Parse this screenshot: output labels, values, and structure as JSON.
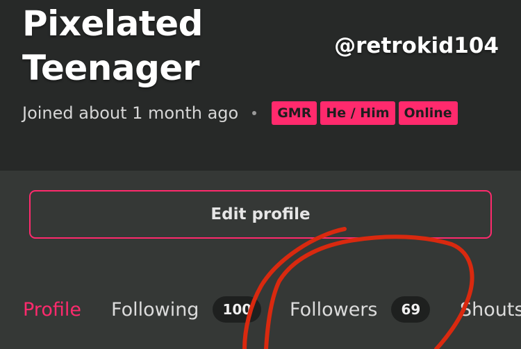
{
  "profile": {
    "display_name": "Pixelated Teenager",
    "handle": "@retrokid104",
    "joined": "Joined about 1 month ago",
    "badges": [
      "GMR",
      "He / Him",
      "Online"
    ]
  },
  "actions": {
    "edit_profile_label": "Edit profile"
  },
  "tabs": [
    {
      "label": "Profile",
      "active": true
    },
    {
      "label": "Following",
      "count": "100"
    },
    {
      "label": "Followers",
      "count": "69"
    },
    {
      "label": "Shouts"
    }
  ],
  "colors": {
    "accent": "#ff2a6d",
    "header_bg": "#272928",
    "body_bg": "#353836",
    "annotation": "#d9290f"
  }
}
